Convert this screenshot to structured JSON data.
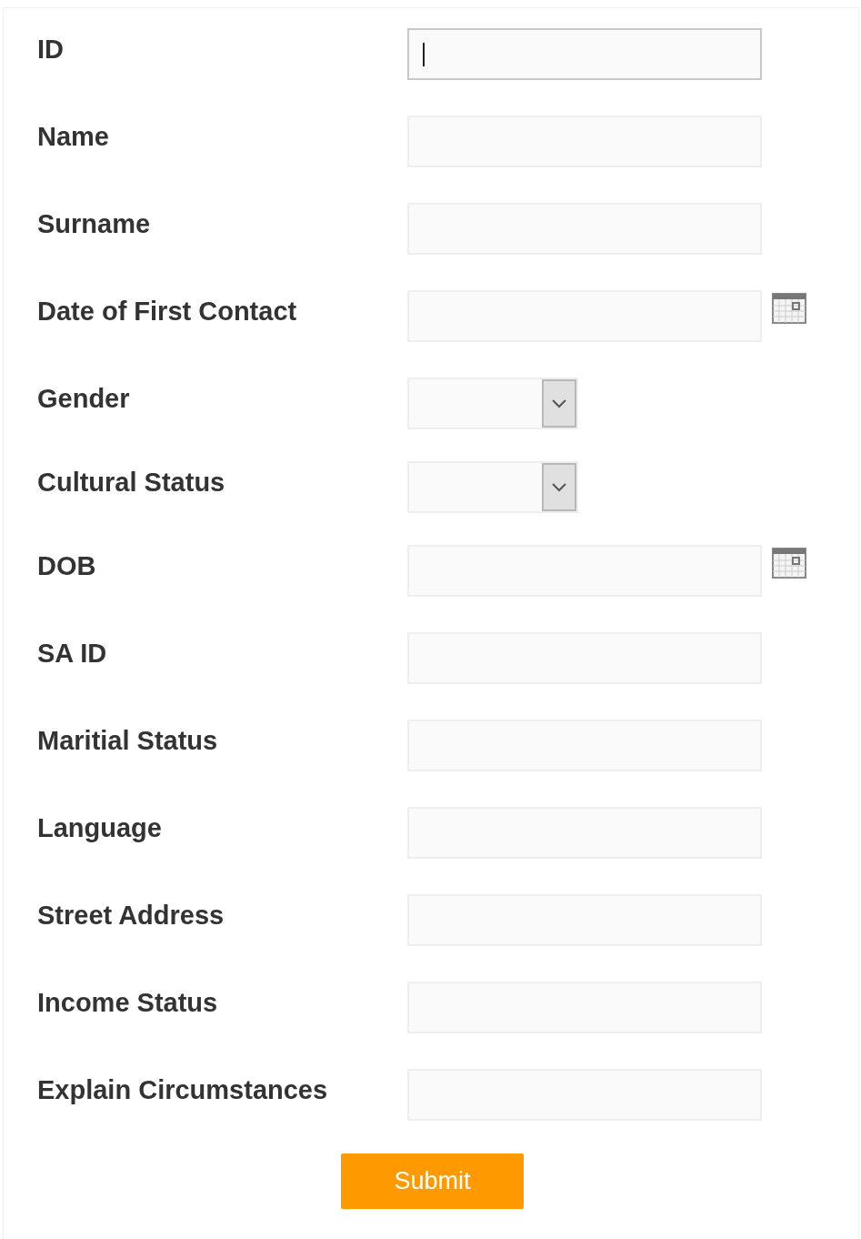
{
  "fields": [
    {
      "label": "ID",
      "kind": "text",
      "focused": true
    },
    {
      "label": "Name",
      "kind": "text",
      "focused": false
    },
    {
      "label": "Surname",
      "kind": "text",
      "focused": false
    },
    {
      "label": "Date of First Contact",
      "kind": "date",
      "focused": false
    },
    {
      "label": "Gender",
      "kind": "select",
      "focused": false
    },
    {
      "label": "Cultural Status",
      "kind": "select",
      "focused": false
    },
    {
      "label": "DOB",
      "kind": "date",
      "focused": false
    },
    {
      "label": "SA ID",
      "kind": "text",
      "focused": false
    },
    {
      "label": "Maritial Status",
      "kind": "text",
      "focused": false
    },
    {
      "label": "Language",
      "kind": "text",
      "focused": false
    },
    {
      "label": "Street Address",
      "kind": "text",
      "focused": false
    },
    {
      "label": "Income Status",
      "kind": "text",
      "focused": false
    },
    {
      "label": "Explain Circumstances",
      "kind": "text",
      "focused": false
    }
  ],
  "submit": "Submit"
}
